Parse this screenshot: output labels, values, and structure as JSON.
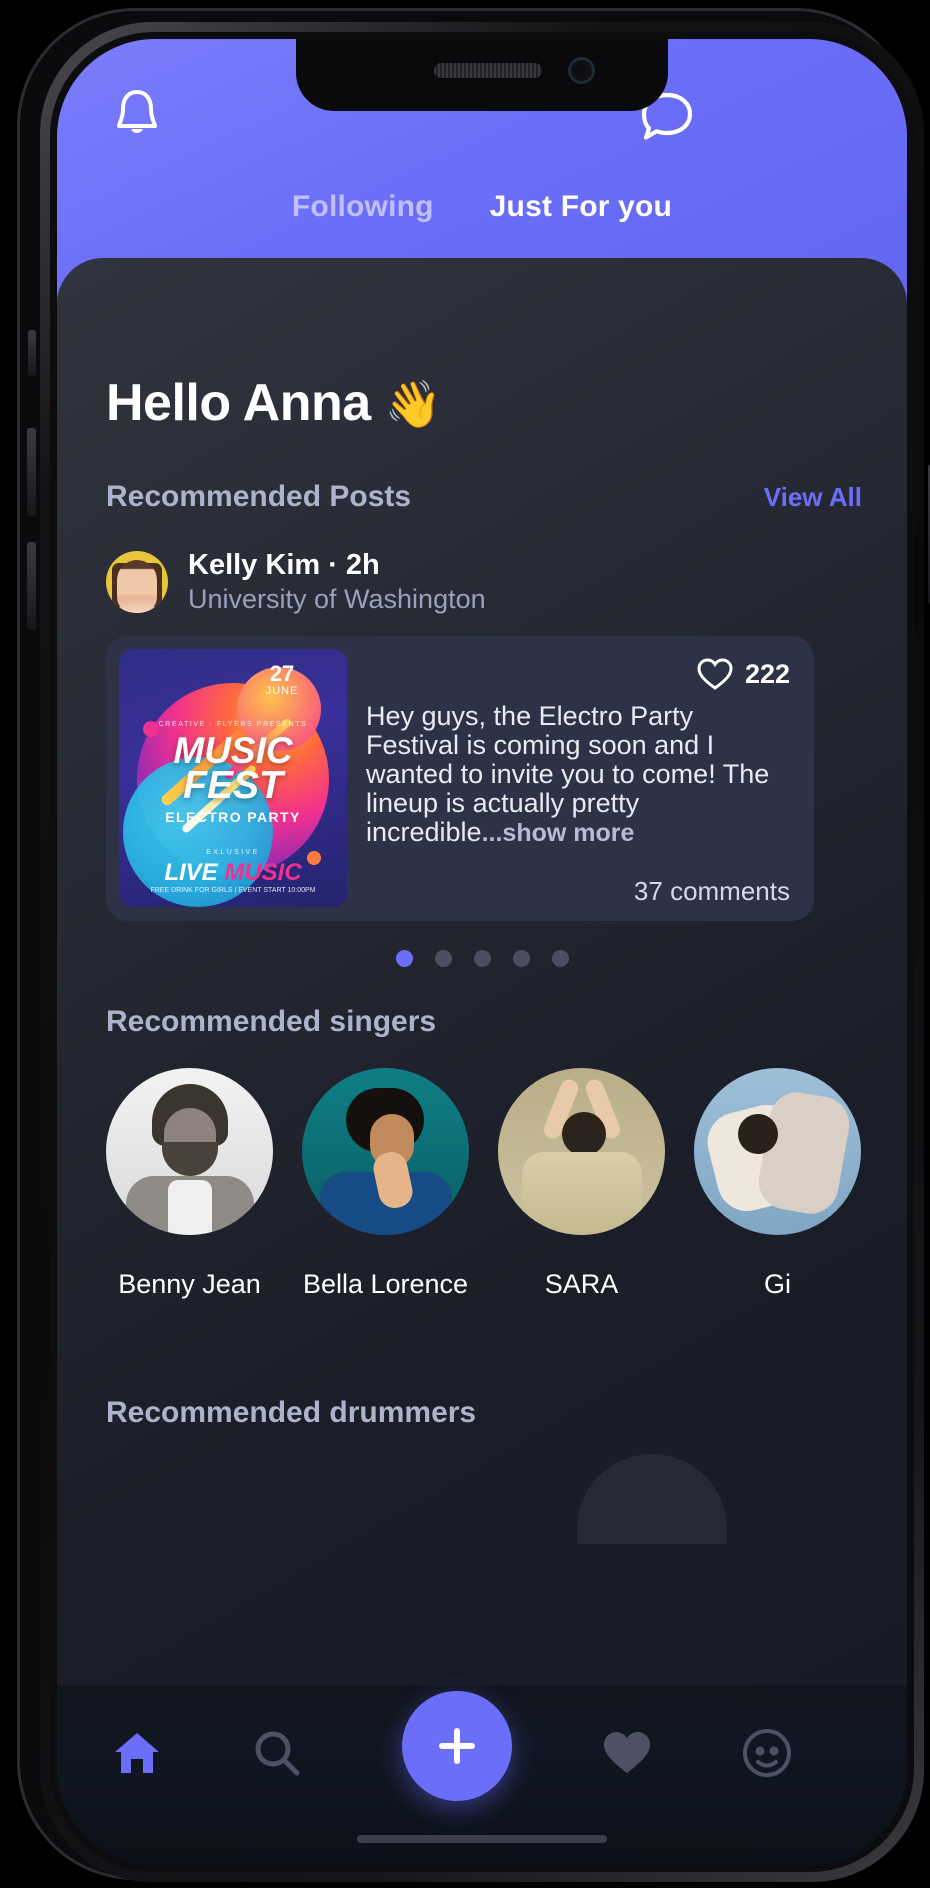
{
  "header": {
    "bell_icon": "bell-icon",
    "chat_icon": "chat-bubble-icon",
    "tabs": [
      {
        "label": "Following",
        "active": false
      },
      {
        "label": "Just For you",
        "active": true
      }
    ]
  },
  "main": {
    "greeting": "Hello Anna",
    "greeting_emoji": "👋",
    "recommended_posts": {
      "title": "Recommended Posts",
      "view_all": "View All"
    },
    "post": {
      "author": "Kelly Kim · 2h",
      "subtitle": "University of Washington",
      "like_count": "222",
      "like_icon": "heart-outline-icon",
      "text": "Hey guys, the Electro Party Festival is coming soon and I wanted to invite you to come! The lineup is actually pretty incredible",
      "show_more": "...show more",
      "comments": "37 comments",
      "poster": {
        "day": "27",
        "month": "JUNE",
        "presents": "CREATIVE · FLYERS PRESENTS",
        "title_line1": "MUSIC",
        "title_line2": "FEST",
        "subtitle": "ELECTRO PARTY",
        "exclusive": "EXLUSIVE",
        "live": "LIVE ",
        "live_accent": "MUSIC",
        "footer": "FREE DRINK FOR GIRLS | EVENT START 10:00PM"
      }
    },
    "carousel": {
      "total": 5,
      "active_index": 0
    },
    "recommended_singers": {
      "title": "Recommended singers",
      "items": [
        {
          "name": "Benny Jean"
        },
        {
          "name": "Bella Lorence"
        },
        {
          "name": "SARA"
        },
        {
          "name": "Gi"
        }
      ]
    },
    "recommended_drummers": {
      "title": "Recommended drummers"
    }
  },
  "bottom_nav": {
    "items": [
      {
        "name": "home-icon",
        "active": true
      },
      {
        "name": "search-icon",
        "active": false
      },
      {
        "name": "add-icon",
        "active": false
      },
      {
        "name": "heart-icon",
        "active": false
      },
      {
        "name": "profile-icon",
        "active": false
      }
    ]
  },
  "colors": {
    "accent": "#6b6ef8",
    "header_gradient_start": "#7b7dfb",
    "background": "#161a24",
    "muted_text": "#aeb3cc"
  }
}
